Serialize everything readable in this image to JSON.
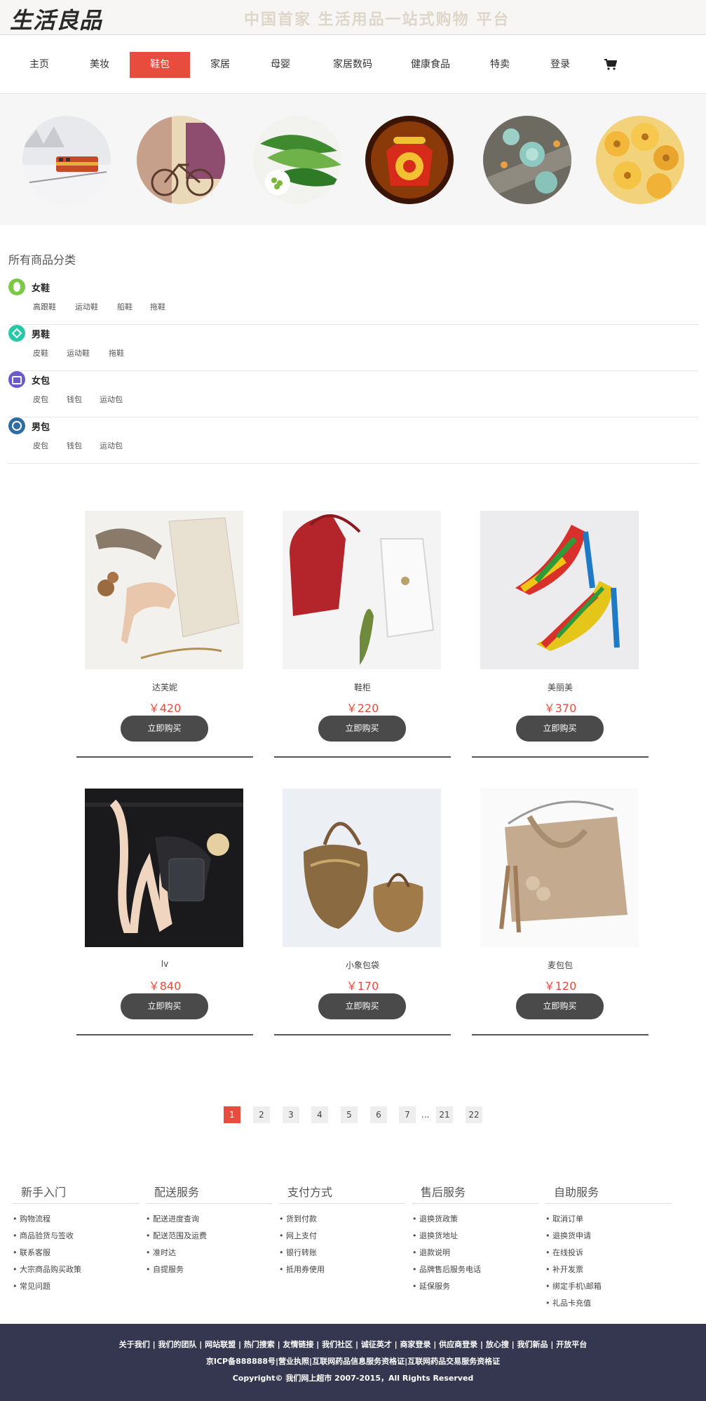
{
  "header": {
    "logo_text": "生活良品",
    "slogan": "中国首家   生活用品一站式购物  平台"
  },
  "nav": {
    "items": [
      {
        "label": "主页"
      },
      {
        "label": "美妆"
      },
      {
        "label": "鞋包",
        "active": true
      },
      {
        "label": "家居"
      },
      {
        "label": "母婴"
      },
      {
        "label": "家居数码"
      },
      {
        "label": "健康食品"
      },
      {
        "label": "特卖"
      },
      {
        "label": "登录"
      }
    ],
    "cart_icon": "cart-icon"
  },
  "banner": {
    "images": [
      "snow-train-photo",
      "vintage-bicycle-photo",
      "green-vegetables-photo",
      "red-telephone-photo",
      "succulent-plants-photo",
      "yellow-flowers-photo"
    ]
  },
  "categories": {
    "title": "所有商品分类",
    "groups": [
      {
        "name": "女鞋",
        "icon": "shoe-icon",
        "color": "#7ac943",
        "subs": [
          "高跟鞋",
          "运动鞋",
          "船鞋",
          "拖鞋"
        ]
      },
      {
        "name": "男鞋",
        "icon": "diamond-icon",
        "color": "#27c8a8",
        "subs": [
          "皮鞋",
          "运动鞋",
          "拖鞋"
        ]
      },
      {
        "name": "女包",
        "icon": "bag-icon",
        "color": "#6a5acd",
        "subs": [
          "皮包",
          "钱包",
          "运动包"
        ]
      },
      {
        "name": "男包",
        "icon": "briefcase-icon",
        "color": "#2e6da4",
        "subs": [
          "皮包",
          "钱包",
          "运动包"
        ]
      }
    ]
  },
  "products": [
    {
      "name": "达芙妮",
      "price": "￥420",
      "buy": "立即购买",
      "image": "heels-and-handbag-photo"
    },
    {
      "name": "鞋柜",
      "price": "￥220",
      "buy": "立即购买",
      "image": "red-and-white-handbags-photo"
    },
    {
      "name": "美丽美",
      "price": "￥370",
      "buy": "立即购买",
      "image": "lego-heels-photo"
    },
    {
      "name": "lv",
      "price": "￥840",
      "buy": "立即购买",
      "image": "model-with-bag-photo"
    },
    {
      "name": "小象包袋",
      "price": "￥170",
      "buy": "立即购买",
      "image": "bronze-handbags-photo"
    },
    {
      "name": "麦包包",
      "price": "￥120",
      "buy": "立即购买",
      "image": "beige-tote-photo"
    }
  ],
  "pagination": {
    "pages": [
      "1",
      "2",
      "3",
      "4",
      "5",
      "6",
      "7",
      "21",
      "22"
    ],
    "current": "1",
    "ellipsis": "..."
  },
  "footer": {
    "columns": [
      {
        "title": "新手入门",
        "links": [
          "购物流程",
          "商品验货与签收",
          "联系客服",
          "大宗商品购买政策",
          "常见问题"
        ]
      },
      {
        "title": "配送服务",
        "links": [
          "配送进度查询",
          "配送范围及运费",
          "准时达",
          "自提服务"
        ]
      },
      {
        "title": "支付方式",
        "links": [
          "货到付款",
          "网上支付",
          "银行转账",
          "抵用券使用"
        ]
      },
      {
        "title": "售后服务",
        "links": [
          "退换货政策",
          "退换货地址",
          "退款说明",
          "品牌售后服务电话",
          "延保服务"
        ]
      },
      {
        "title": "自助服务",
        "links": [
          "取消订单",
          "退换货申请",
          "在线投诉",
          "补开发票",
          "绑定手机\\邮箱",
          "礼品卡充值"
        ]
      }
    ],
    "bottom_links": "关于我们 | 我们的团队 | 网站联盟 | 热门搜索 | 友情链接 | 我们社区 | 诚征英才 | 商家登录 | 供应商登录 | 放心搜 | 我们新品 | 开放平台",
    "license": "京ICP备888888号|营业执照|互联网药品信息服务资格证|互联网药品交易服务资格证",
    "copyright": "Copyright© 我们网上超市 2007-2015，All Rights Reserved"
  },
  "colors": {
    "accent": "#e74c3c",
    "footer_bg": "#353751",
    "button_bg": "#4a4a4a"
  }
}
